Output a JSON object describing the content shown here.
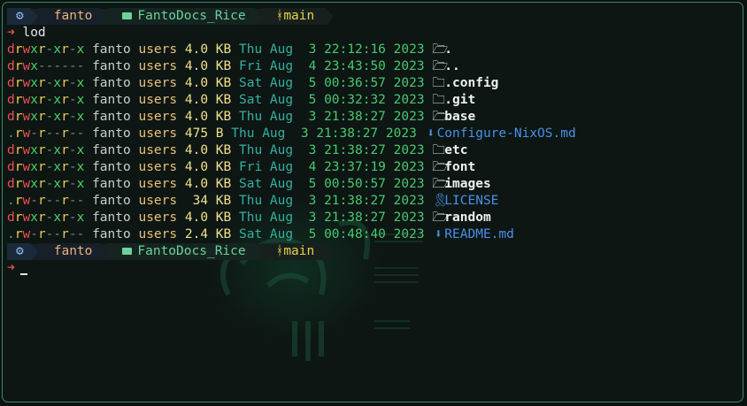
{
  "prompt": {
    "gear_icon": "gear-icon",
    "user": "fanto",
    "directory": "FantoDocs_Rice",
    "branch": "main",
    "arrow_glyph": "➜"
  },
  "command": "lod",
  "listing": [
    {
      "perm": "drwxr-xr-x",
      "owner": "fanto",
      "group": "users",
      "size": "4.0 KB",
      "day": "Thu",
      "mon": "Aug",
      "dd": " 3",
      "time": "22:12:16",
      "year": "2023",
      "icon": "folder-open",
      "name": ".",
      "kind": "dir"
    },
    {
      "perm": "drwx------",
      "owner": "fanto",
      "group": "users",
      "size": "4.0 KB",
      "day": "Fri",
      "mon": "Aug",
      "dd": " 4",
      "time": "23:43:50",
      "year": "2023",
      "icon": "folder-open",
      "name": "..",
      "kind": "dir"
    },
    {
      "perm": "drwxr-xr-x",
      "owner": "fanto",
      "group": "users",
      "size": "4.0 KB",
      "day": "Sat",
      "mon": "Aug",
      "dd": " 5",
      "time": "00:36:57",
      "year": "2023",
      "icon": "folder-gear",
      "name": ".config",
      "kind": "dir"
    },
    {
      "perm": "drwxr-xr-x",
      "owner": "fanto",
      "group": "users",
      "size": "4.0 KB",
      "day": "Sat",
      "mon": "Aug",
      "dd": " 5",
      "time": "00:32:32",
      "year": "2023",
      "icon": "folder-git",
      "name": ".git",
      "kind": "dir"
    },
    {
      "perm": "drwxr-xr-x",
      "owner": "fanto",
      "group": "users",
      "size": "4.0 KB",
      "day": "Thu",
      "mon": "Aug",
      "dd": " 3",
      "time": "21:38:27",
      "year": "2023",
      "icon": "folder-open",
      "name": "base",
      "kind": "dir"
    },
    {
      "perm": ".rw-r--r--",
      "owner": "fanto",
      "group": "users",
      "size": "475 B",
      "day": "Thu",
      "mon": "Aug",
      "dd": " 3",
      "time": "21:38:27",
      "year": "2023",
      "icon": "markdown-down",
      "name": "Configure-NixOS.md",
      "kind": "file"
    },
    {
      "perm": "drwxr-xr-x",
      "owner": "fanto",
      "group": "users",
      "size": "4.0 KB",
      "day": "Thu",
      "mon": "Aug",
      "dd": " 3",
      "time": "21:38:27",
      "year": "2023",
      "icon": "folder-gear",
      "name": "etc",
      "kind": "dir"
    },
    {
      "perm": "drwxr-xr-x",
      "owner": "fanto",
      "group": "users",
      "size": "4.0 KB",
      "day": "Fri",
      "mon": "Aug",
      "dd": " 4",
      "time": "23:37:19",
      "year": "2023",
      "icon": "folder-open",
      "name": "font",
      "kind": "dir"
    },
    {
      "perm": "drwxr-xr-x",
      "owner": "fanto",
      "group": "users",
      "size": "4.0 KB",
      "day": "Sat",
      "mon": "Aug",
      "dd": " 5",
      "time": "00:50:57",
      "year": "2023",
      "icon": "folder-open",
      "name": "images",
      "kind": "dir"
    },
    {
      "perm": ".rw-r--r--",
      "owner": "fanto",
      "group": "users",
      "size": " 34 KB",
      "day": "Thu",
      "mon": "Aug",
      "dd": " 3",
      "time": "21:38:27",
      "year": "2023",
      "icon": "license-ribbon",
      "name": "LICENSE",
      "kind": "file"
    },
    {
      "perm": "drwxr-xr-x",
      "owner": "fanto",
      "group": "users",
      "size": "4.0 KB",
      "day": "Thu",
      "mon": "Aug",
      "dd": " 3",
      "time": "21:38:27",
      "year": "2023",
      "icon": "folder-open",
      "name": "random",
      "kind": "dir"
    },
    {
      "perm": ".rw-r--r--",
      "owner": "fanto",
      "group": "users",
      "size": "2.4 KB",
      "day": "Sat",
      "mon": "Aug",
      "dd": " 5",
      "time": "00:48:40",
      "year": "2023",
      "icon": "markdown-down",
      "name": "README.md",
      "kind": "file"
    }
  ],
  "colors": {
    "background": "#0d1613",
    "border": "#3a8a6a",
    "accent_green": "#48c870",
    "accent_red": "#ef4f4f",
    "accent_yellow": "#e8cf57",
    "file_blue": "#4a8fe8"
  }
}
